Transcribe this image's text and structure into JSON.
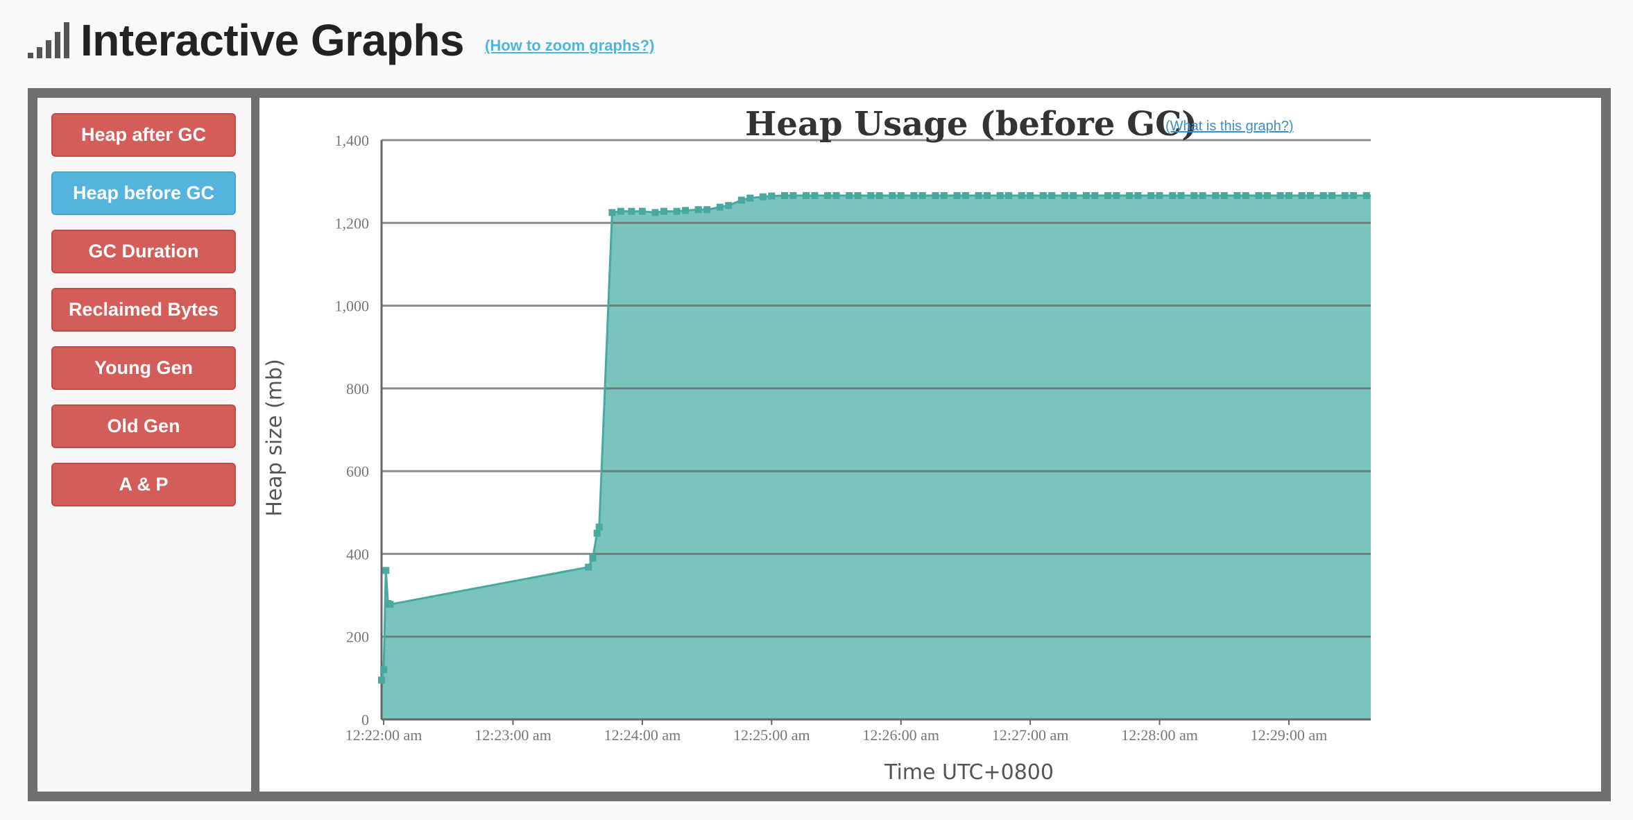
{
  "header": {
    "title": "Interactive Graphs",
    "help_link": "(How to zoom graphs?)",
    "icon": "signal-bars-icon"
  },
  "sidebar": {
    "buttons": [
      {
        "label": "Heap after GC",
        "active": false
      },
      {
        "label": "Heap before GC",
        "active": true
      },
      {
        "label": "GC Duration",
        "active": false
      },
      {
        "label": "Reclaimed Bytes",
        "active": false
      },
      {
        "label": "Young Gen",
        "active": false
      },
      {
        "label": "Old Gen",
        "active": false
      },
      {
        "label": "A & P",
        "active": false
      }
    ]
  },
  "colors": {
    "accent": "#55b4dd",
    "button_red": "#d35d58",
    "series_line": "#4aa99e",
    "series_fill": "#79c5be"
  },
  "chart_data": {
    "type": "area",
    "title": "Heap Usage (before GC)",
    "help_link": "(What is this graph?)",
    "xlabel": "Time UTC+0800",
    "ylabel": "Heap size (mb)",
    "ylim": [
      0,
      1400
    ],
    "yticks": [
      "0",
      "200",
      "400",
      "600",
      "800",
      "1,000",
      "1,200",
      "1,400"
    ],
    "ytick_values": [
      0,
      200,
      400,
      600,
      800,
      1000,
      1200,
      1400
    ],
    "xticks": [
      "12:22:00 am",
      "12:23:00 am",
      "12:24:00 am",
      "12:25:00 am",
      "12:26:00 am",
      "12:27:00 am",
      "12:28:00 am",
      "12:29:00 am"
    ],
    "xtick_values": [
      "00:22:00",
      "00:23:00",
      "00:24:00",
      "00:25:00",
      "00:26:00",
      "00:27:00",
      "00:28:00",
      "00:29:00"
    ],
    "xlim": [
      "00:21:59",
      "00:29:38"
    ],
    "grid": true,
    "series": [
      {
        "x": [
          "00:21:59",
          "00:22:00",
          "00:22:01",
          "00:22:02",
          "00:22:03",
          "00:23:35",
          "00:23:37",
          "00:23:39",
          "00:23:40",
          "00:23:46",
          "00:23:50",
          "00:23:55",
          "00:24:00",
          "00:24:06",
          "00:24:10",
          "00:24:16",
          "00:24:20",
          "00:24:26",
          "00:24:30",
          "00:24:36",
          "00:24:40",
          "00:24:46",
          "00:24:50",
          "00:24:56",
          "00:25:00",
          "00:25:06",
          "00:25:10",
          "00:25:16",
          "00:25:20",
          "00:25:26",
          "00:25:30",
          "00:25:36",
          "00:25:40",
          "00:25:46",
          "00:25:50",
          "00:25:56",
          "00:26:00",
          "00:26:06",
          "00:26:10",
          "00:26:16",
          "00:26:20",
          "00:26:26",
          "00:26:30",
          "00:26:36",
          "00:26:40",
          "00:26:46",
          "00:26:50",
          "00:26:56",
          "00:27:00",
          "00:27:06",
          "00:27:10",
          "00:27:16",
          "00:27:20",
          "00:27:26",
          "00:27:30",
          "00:27:36",
          "00:27:40",
          "00:27:46",
          "00:27:50",
          "00:27:56",
          "00:28:00",
          "00:28:06",
          "00:28:10",
          "00:28:16",
          "00:28:20",
          "00:28:26",
          "00:28:30",
          "00:28:36",
          "00:28:40",
          "00:28:46",
          "00:28:50",
          "00:28:56",
          "00:29:00",
          "00:29:06",
          "00:29:10",
          "00:29:16",
          "00:29:20",
          "00:29:26",
          "00:29:30",
          "00:29:36"
        ],
        "values": [
          95,
          120,
          360,
          280,
          278,
          368,
          390,
          450,
          465,
          1225,
          1228,
          1228,
          1228,
          1225,
          1228,
          1228,
          1230,
          1232,
          1232,
          1238,
          1242,
          1255,
          1260,
          1263,
          1265,
          1266,
          1266,
          1266,
          1266,
          1266,
          1266,
          1266,
          1266,
          1266,
          1266,
          1266,
          1266,
          1266,
          1266,
          1266,
          1266,
          1266,
          1266,
          1266,
          1266,
          1266,
          1266,
          1266,
          1266,
          1266,
          1266,
          1266,
          1266,
          1266,
          1266,
          1266,
          1266,
          1266,
          1266,
          1266,
          1266,
          1266,
          1266,
          1266,
          1266,
          1266,
          1266,
          1266,
          1266,
          1266,
          1266,
          1266,
          1266,
          1266,
          1266,
          1266,
          1266,
          1266,
          1266,
          1266
        ]
      }
    ]
  }
}
